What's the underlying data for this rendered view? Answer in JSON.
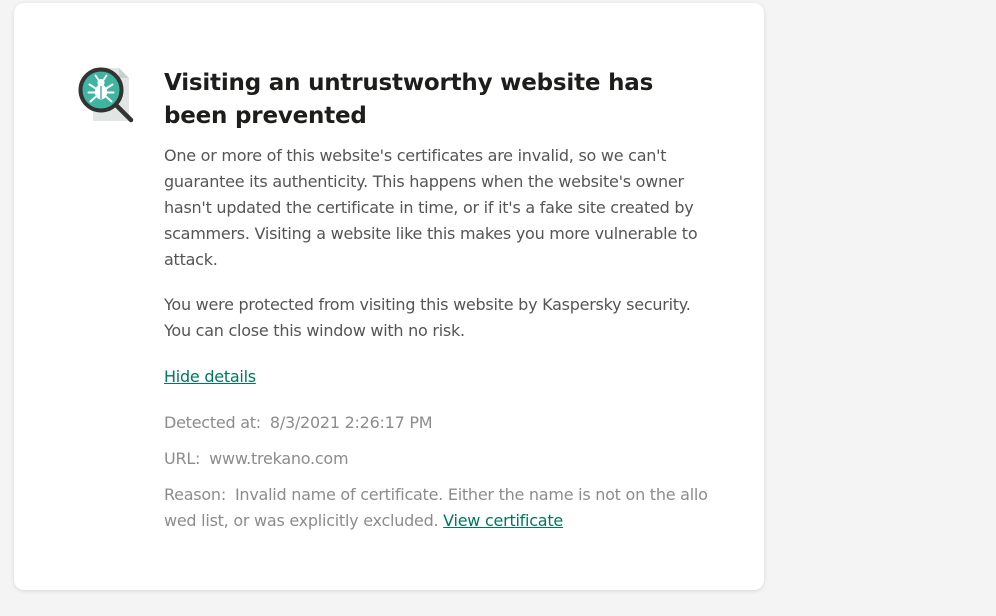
{
  "dialog": {
    "title": "Visiting an untrustworthy website has been prevented",
    "paragraph1": "One or more of this website's certificates are invalid, so we can't guarantee its authenticity. This happens when the website's owner hasn't updated the certificate in time, or if it's a fake site created by scammers. Visiting a website like this makes you more vulnerable to attack.",
    "paragraph2": "You were protected from visiting this website by Kaspersky security. You can close this window with no risk.",
    "hide_details_label": "Hide details",
    "icon": "bug-magnifier-icon"
  },
  "details": {
    "detected_label": "Detected at:",
    "detected_value": "8/3/2021 2:26:17 PM",
    "url_label": "URL:",
    "url_value": "www.trekano.com",
    "reason_label": "Reason:",
    "reason_value": "Invalid name of certificate. Either the name is not on the allo wed list, or was explicitly excluded.",
    "view_certificate_label": "View certificate"
  },
  "colors": {
    "accent": "#00765f",
    "icon_teal": "#3fb4a0",
    "icon_dark": "#333333",
    "background": "#f4f4f4"
  }
}
